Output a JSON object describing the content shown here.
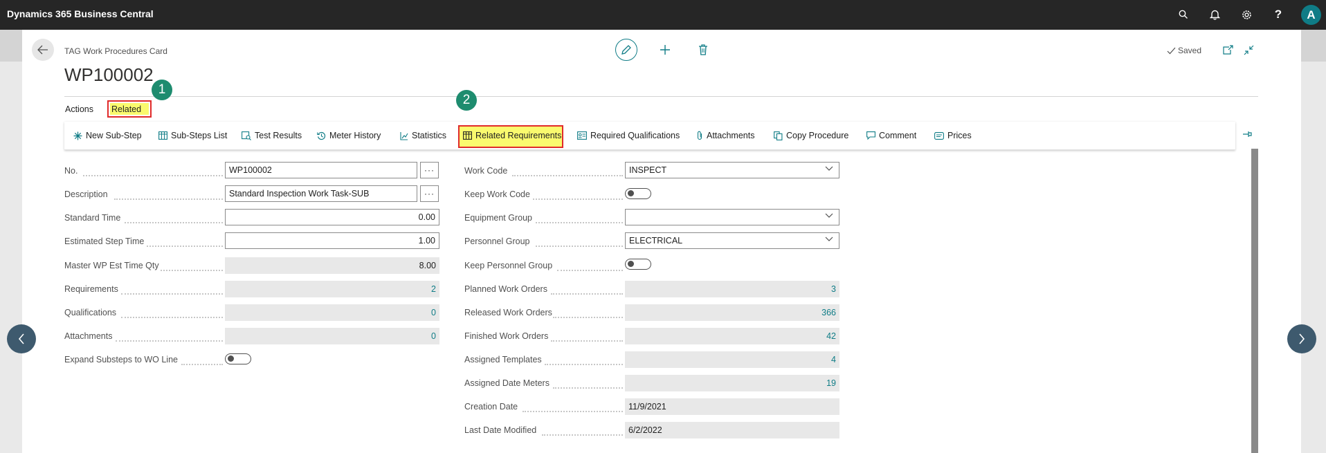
{
  "app": {
    "title": "Dynamics 365 Business Central",
    "avatar_initial": "A",
    "accent": "#0f7c86"
  },
  "page": {
    "caption": "TAG Work Procedures Card",
    "title": "WP100002",
    "saved_label": "Saved"
  },
  "menu": {
    "actions": "Actions",
    "related": "Related"
  },
  "callouts": {
    "one": "1",
    "two": "2"
  },
  "actions": {
    "new_sub_step": "New Sub-Step",
    "sub_steps_list": "Sub-Steps List",
    "test_results": "Test Results",
    "meter_history": "Meter History",
    "statistics": "Statistics",
    "related_requirements": "Related Requirements",
    "required_qualifications": "Required Qualifications",
    "attachments": "Attachments",
    "copy_procedure": "Copy Procedure",
    "comment": "Comment",
    "prices": "Prices"
  },
  "left_fields": {
    "no": {
      "label": "No.",
      "value": "WP100002"
    },
    "description": {
      "label": "Description",
      "value": "Standard Inspection Work Task-SUB"
    },
    "standard_time": {
      "label": "Standard Time",
      "value": "0.00"
    },
    "estimated_step_time": {
      "label": "Estimated Step Time",
      "value": "1.00"
    },
    "master_wp_est_time_qty": {
      "label": "Master WP Est Time Qty",
      "value": "8.00"
    },
    "requirements": {
      "label": "Requirements",
      "value": "2"
    },
    "qualifications": {
      "label": "Qualifications",
      "value": "0"
    },
    "attachments": {
      "label": "Attachments",
      "value": "0"
    },
    "expand_substeps": {
      "label": "Expand Substeps to WO Line"
    }
  },
  "right_fields": {
    "work_code": {
      "label": "Work Code",
      "value": "INSPECT"
    },
    "keep_work_code": {
      "label": "Keep Work Code"
    },
    "equipment_group": {
      "label": "Equipment Group",
      "value": ""
    },
    "personnel_group": {
      "label": "Personnel Group",
      "value": "ELECTRICAL"
    },
    "keep_personnel_group": {
      "label": "Keep Personnel Group"
    },
    "planned_work_orders": {
      "label": "Planned Work Orders",
      "value": "3"
    },
    "released_work_orders": {
      "label": "Released Work Orders",
      "value": "366"
    },
    "finished_work_orders": {
      "label": "Finished Work Orders",
      "value": "42"
    },
    "assigned_templates": {
      "label": "Assigned Templates",
      "value": "4"
    },
    "assigned_date_meters": {
      "label": "Assigned Date Meters",
      "value": "19"
    },
    "creation_date": {
      "label": "Creation Date",
      "value": "11/9/2021"
    },
    "last_date_modified": {
      "label": "Last Date Modified",
      "value": "6/2/2022"
    }
  }
}
